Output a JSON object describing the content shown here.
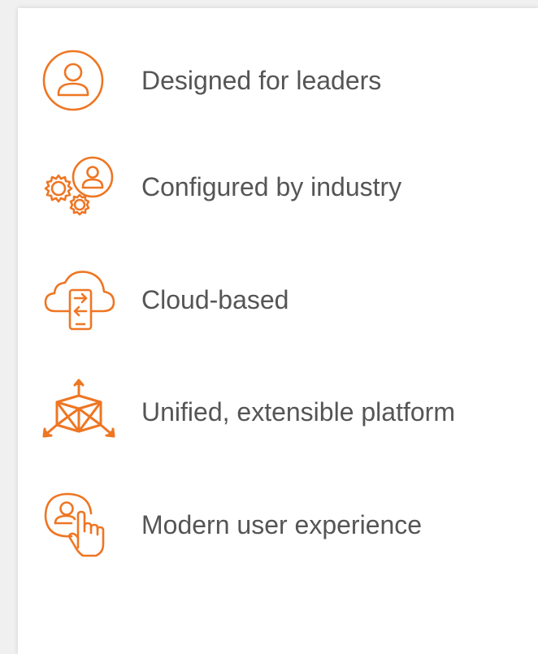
{
  "theme": {
    "accent": "#ee7623",
    "text": "#555555",
    "card_background": "#ffffff"
  },
  "features": [
    {
      "icon": "user-circle-icon",
      "label": "Designed for leaders"
    },
    {
      "icon": "gears-user-icon",
      "label": "Configured by industry"
    },
    {
      "icon": "cloud-mobile-icon",
      "label": "Cloud-based"
    },
    {
      "icon": "cube-arrows-icon",
      "label": "Unified, extensible platform"
    },
    {
      "icon": "user-touch-icon",
      "label": "Modern user experience"
    }
  ]
}
